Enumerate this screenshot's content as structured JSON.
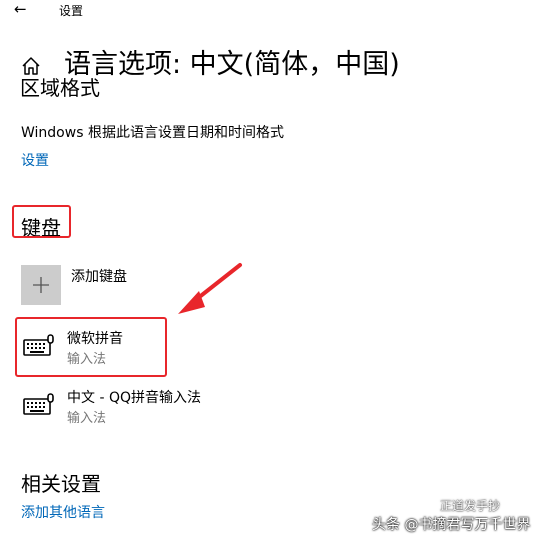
{
  "window": {
    "title": "设置",
    "back_icon": "back-arrow-icon"
  },
  "header": {
    "home_icon": "home-icon",
    "title": "语言选项: 中文(简体，中国)"
  },
  "region": {
    "heading_partial": "区域格式",
    "description": "Windows 根据此语言设置日期和时间格式",
    "settings_link": "设置"
  },
  "keyboard": {
    "heading": "键盘",
    "add_label": "添加键盘",
    "add_icon": "plus-icon",
    "items": [
      {
        "name": "微软拼音",
        "type": "输入法",
        "icon": "keyboard-icon"
      },
      {
        "name": "中文 - QQ拼音输入法",
        "type": "输入法",
        "icon": "keyboard-icon"
      }
    ]
  },
  "related": {
    "heading": "相关设置",
    "add_language_link": "添加其他语言"
  },
  "annotations": {
    "highlight_color": "#e8262b"
  },
  "watermark": {
    "line1": "头条 @书摘君写万千世界",
    "line2": "正道发手抄"
  },
  "colors": {
    "link": "#0067b8",
    "secondary_text": "#767676",
    "plus_tile": "#cccccc"
  }
}
